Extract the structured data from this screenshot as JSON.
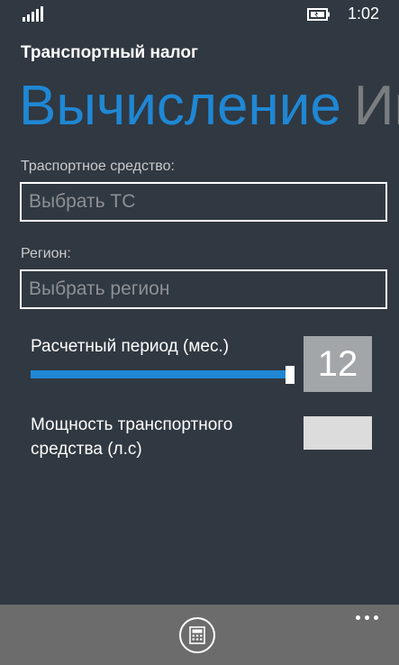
{
  "status_bar": {
    "signal_icon": "signal-strength-icon",
    "battery_icon": "battery-charging-icon",
    "time": "1:02"
  },
  "app": {
    "title": "Транспортный налог"
  },
  "pivot": {
    "items": [
      {
        "label": "Вычисление"
      },
      {
        "label": "Ин"
      }
    ],
    "active_color": "#1f87d4",
    "inactive_color": "#7a7d80"
  },
  "form": {
    "vehicle": {
      "label": "Траспортное средство:",
      "placeholder": "Выбрать ТС"
    },
    "region": {
      "label": "Регион:",
      "placeholder": "Выбрать регион"
    },
    "period": {
      "label": "Расчетный период (мес.)",
      "value": "12",
      "min": 0,
      "max": 12,
      "fraction": 1.0
    },
    "power": {
      "label": "Мощность транспортного средства (л.с)",
      "value": ""
    }
  },
  "app_bar": {
    "calc_icon": "calculator-icon",
    "more_icon": "more-dots-icon",
    "background": "#6c6c6c"
  },
  "colors": {
    "background": "#303841",
    "accent": "#1f87d4",
    "value_box": "#a3a6a8",
    "input_fill": "#dcdcdc"
  }
}
